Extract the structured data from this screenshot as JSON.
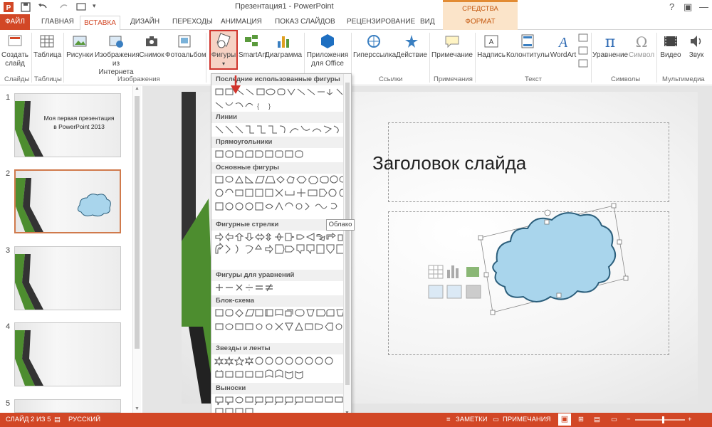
{
  "window": {
    "title": "Презентация1 - PowerPoint",
    "tools_title": "СРЕДСТВА РИСОВАНИЯ",
    "help": "?",
    "minimize": "—",
    "restore": "☐"
  },
  "tabs": {
    "file": "ФАЙЛ",
    "home": "ГЛАВНАЯ",
    "insert": "ВСТАВКА",
    "design": "ДИЗАЙН",
    "transitions": "ПЕРЕХОДЫ",
    "animation": "АНИМАЦИЯ",
    "slideshow": "ПОКАЗ СЛАЙДОВ",
    "review": "РЕЦЕНЗИРОВАНИЕ",
    "view": "ВИД",
    "format": "ФОРМАТ"
  },
  "ribbon": {
    "new_slide": "Создать слайд",
    "table": "Таблица",
    "pictures": "Рисунки",
    "online_pictures": "Изображения из Интернета",
    "screenshot": "Снимок",
    "album": "Фотоальбом",
    "shapes": "Фигуры",
    "smartart": "SmartArt",
    "chart": "Диаграмма",
    "apps": "Приложения для Office",
    "hyperlink": "Гиперссылка",
    "action": "Действие",
    "comment": "Примечание",
    "textbox": "Надпись",
    "header_footer": "Колонтитулы",
    "wordart": "WordArt",
    "equation": "Уравнение",
    "symbol": "Символ",
    "video": "Видео",
    "audio": "Звук",
    "groups": {
      "slides": "Слайды",
      "tables": "Таблицы",
      "images": "Изображения",
      "links": "Ссылки",
      "comments": "Примечания",
      "text": "Текст",
      "symbols": "Символы",
      "media": "Мультимедиа"
    }
  },
  "slides": [
    {
      "num": "1",
      "text": "Моя первая презентация в PowerPoint 2013"
    },
    {
      "num": "2",
      "text": ""
    },
    {
      "num": "3",
      "text": ""
    },
    {
      "num": "4",
      "text": ""
    },
    {
      "num": "5",
      "text": ""
    }
  ],
  "slide": {
    "title": "Заголовок слайда"
  },
  "gallery": {
    "sections": [
      "Последние использованные фигуры",
      "Линии",
      "Прямоугольники",
      "Основные фигуры",
      "Фигурные стрелки",
      "Фигуры для уравнений",
      "Блок-схема",
      "Звезды и ленты",
      "Выноски"
    ],
    "tooltip": "Облако"
  },
  "status": {
    "slide": "СЛАЙД 2 ИЗ 5",
    "lang": "РУССКИЙ",
    "notes": "ЗАМЕТКИ",
    "comments": "ПРИМЕЧАНИЯ"
  },
  "colors": {
    "accent": "#d24726",
    "cloud_fill": "#a9d5ec",
    "cloud_stroke": "#2c5f7c"
  }
}
